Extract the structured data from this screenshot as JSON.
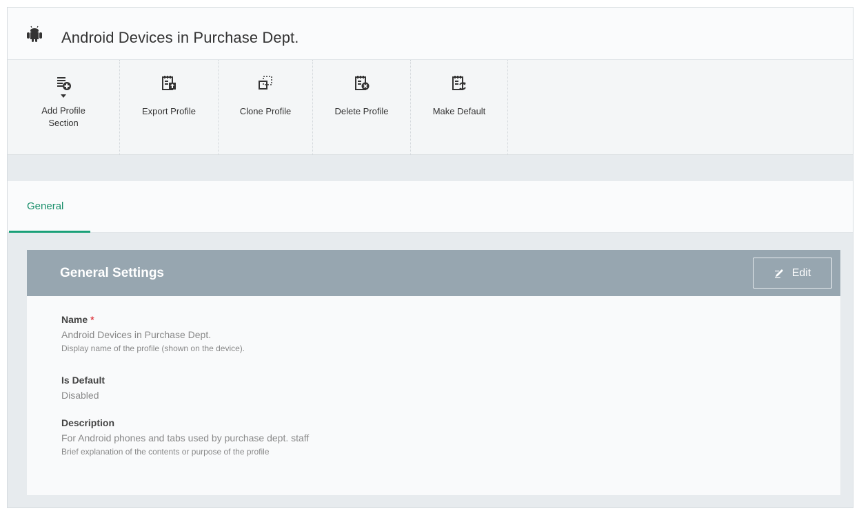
{
  "header": {
    "title": "Android Devices in Purchase Dept.",
    "icon": "android-icon"
  },
  "toolbar": {
    "items": [
      {
        "label_line1": "Add Profile",
        "label_line2": "Section",
        "icon": "add-section-icon",
        "has_dropdown": true
      },
      {
        "label": "Export Profile",
        "icon": "export-icon"
      },
      {
        "label": "Clone Profile",
        "icon": "clone-icon"
      },
      {
        "label": "Delete Profile",
        "icon": "delete-icon"
      },
      {
        "label": "Make Default",
        "icon": "make-default-icon"
      }
    ]
  },
  "tabs": [
    {
      "label": "General",
      "active": true
    }
  ],
  "panel": {
    "title": "General Settings",
    "edit_label": "Edit",
    "fields": {
      "name": {
        "label": "Name",
        "required_mark": "*",
        "value": "Android Devices in Purchase Dept.",
        "help": "Display name of the profile (shown on the device)."
      },
      "is_default": {
        "label": "Is Default",
        "value": "Disabled"
      },
      "description": {
        "label": "Description",
        "value": "For Android phones and tabs used by purchase dept. staff",
        "help": "Brief explanation of the contents or purpose of the profile"
      }
    }
  },
  "colors": {
    "accent": "#1aa078",
    "panel_header": "#97a6b0",
    "required": "#e0464d"
  }
}
